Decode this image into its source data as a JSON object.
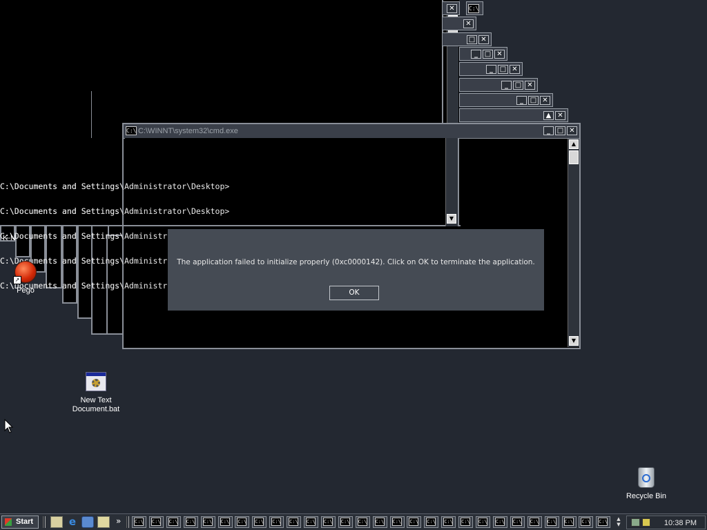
{
  "cmd_window": {
    "title": "C:\\WINNT\\system32\\cmd.exe",
    "icon": "C:\\",
    "min": "_",
    "max": "□",
    "close": "✕"
  },
  "console_lines": [
    "C:\\Documents and Settings\\Administrator\\Desktop>",
    "C:\\Documents and Settings\\Administrator\\Desktop>",
    "C:\\Documents and Settings\\Administrator\\Desktop>start",
    "C:\\Documents and Settings\\Administrator\\Desktop>start",
    "C:\\Documents and Settings\\Administrator\\Desktop>start cmd"
  ],
  "dialog": {
    "message": "The application failed to initialize properly (0xc0000142). Click on OK to terminate the application.",
    "ok_label": "OK"
  },
  "desktop_icons": {
    "kn_label": "K-N",
    "pego_label": "Pego",
    "bat_label_line1": "New Text",
    "bat_label_line2": "Document.bat",
    "recycle_label": "Recycle Bin"
  },
  "taskbar": {
    "start_label": "Start",
    "chevron": "»",
    "cmd_button_icon": "C:\\",
    "cmd_button_count": 28,
    "clock": "10:38 PM"
  },
  "icons": {
    "start": "windows-flag-icon",
    "quicklaunch": [
      "outlook-icon",
      "internet-explorer-icon",
      "outlook-express-icon",
      "show-desktop-icon"
    ],
    "tray": [
      "network-icon",
      "speaker-icon"
    ]
  },
  "colors": {
    "desktop": "#232831",
    "dialog": "#454b54",
    "console_bg": "#000000"
  }
}
